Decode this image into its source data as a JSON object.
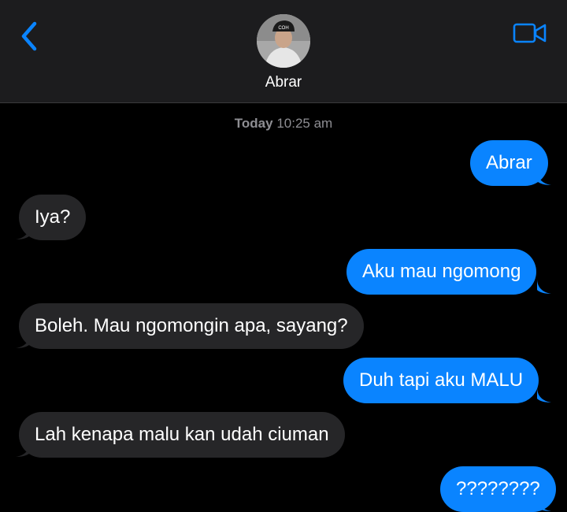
{
  "header": {
    "contact_name": "Abrar",
    "avatar_cap_text": "COH",
    "back_icon": "chevron-left-icon",
    "video_icon": "video-camera-icon"
  },
  "timestamp": {
    "day": "Today",
    "time": "10:25 am"
  },
  "messages": [
    {
      "direction": "outgoing",
      "text": "Abrar"
    },
    {
      "direction": "incoming",
      "text": "Iya?"
    },
    {
      "direction": "outgoing",
      "text": "Aku mau ngomong"
    },
    {
      "direction": "incoming",
      "text": "Boleh. Mau ngomongin apa, sayang?"
    },
    {
      "direction": "outgoing",
      "text": "Duh tapi aku MALU"
    },
    {
      "direction": "incoming",
      "text": "Lah kenapa malu kan udah ciuman"
    },
    {
      "direction": "outgoing",
      "text": "????????"
    }
  ],
  "colors": {
    "accent": "#0a84ff",
    "outgoing_bubble": "#0a84ff",
    "incoming_bubble": "#262628",
    "header_bg": "#1c1c1e",
    "background": "#000000",
    "timestamp": "#8e8e93"
  }
}
